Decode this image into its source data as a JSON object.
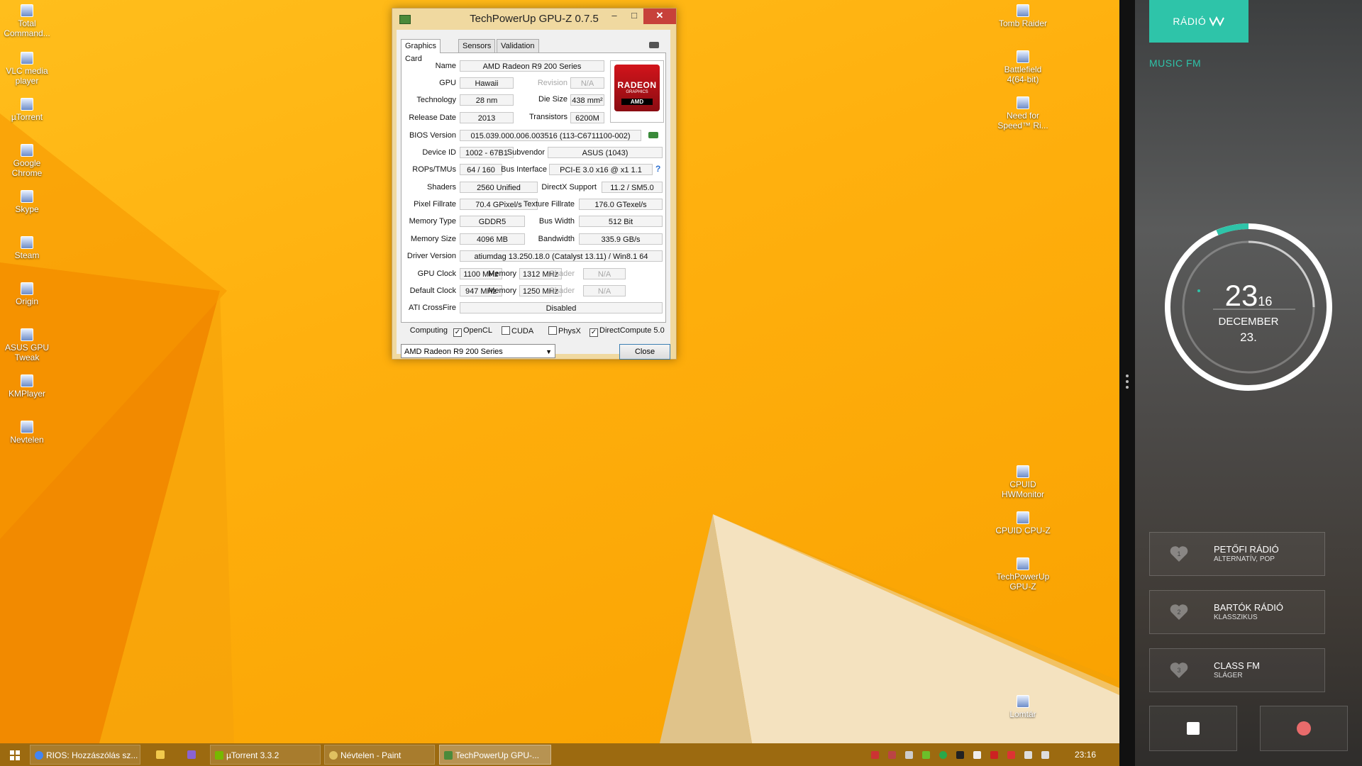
{
  "desktop": {
    "left_icons": [
      {
        "label": "Total Command..."
      },
      {
        "label": "VLC media player"
      },
      {
        "label": "µTorrent"
      },
      {
        "label": "Google Chrome"
      },
      {
        "label": "Skype"
      },
      {
        "label": "Steam"
      },
      {
        "label": "Origin"
      },
      {
        "label": "ASUS GPU Tweak"
      },
      {
        "label": "KMPlayer"
      },
      {
        "label": "Nevtelen"
      }
    ],
    "right_icons": [
      {
        "label": "Tomb Raider"
      },
      {
        "label": "Battlefield 4(64-bit)"
      },
      {
        "label": "Need for Speed™ Ri..."
      },
      {
        "label": "CPUID HWMonitor"
      },
      {
        "label": "CPUID CPU-Z"
      },
      {
        "label": "TechPowerUp GPU-Z"
      },
      {
        "label": "Lomtár"
      }
    ]
  },
  "gpuz": {
    "title": "TechPowerUp GPU-Z 0.7.5",
    "tabs": [
      "Graphics Card",
      "Sensors",
      "Validation"
    ],
    "logo": {
      "line1": "RADEON",
      "line2": "GRAPHICS",
      "line3": "AMD"
    },
    "labels": {
      "name": "Name",
      "gpu": "GPU",
      "revision": "Revision",
      "technology": "Technology",
      "die_size": "Die Size",
      "release_date": "Release Date",
      "transistors": "Transistors",
      "bios_version": "BIOS Version",
      "device_id": "Device ID",
      "subvendor": "Subvendor",
      "rops_tmus": "ROPs/TMUs",
      "bus_interface": "Bus Interface",
      "shaders": "Shaders",
      "directx": "DirectX Support",
      "pixel_fillrate": "Pixel Fillrate",
      "texture_fillrate": "Texture Fillrate",
      "memory_type": "Memory Type",
      "bus_width": "Bus Width",
      "memory_size": "Memory Size",
      "bandwidth": "Bandwidth",
      "driver_version": "Driver Version",
      "gpu_clock": "GPU Clock",
      "memory": "Memory",
      "shader": "Shader",
      "default_clock": "Default Clock",
      "crossfire": "ATI CrossFire",
      "computing": "Computing"
    },
    "values": {
      "name": "AMD Radeon R9 200 Series",
      "gpu": "Hawaii",
      "revision": "N/A",
      "technology": "28 nm",
      "die_size": "438 mm²",
      "release_date": "2013",
      "transistors": "6200M",
      "bios_version": "015.039.000.006.003516 (113-C6711100-002)",
      "device_id": "1002 - 67B1",
      "subvendor": "ASUS (1043)",
      "rops_tmus": "64 / 160",
      "bus_interface": "PCI-E 3.0 x16 @ x1 1.1",
      "shaders": "2560 Unified",
      "directx": "11.2 / SM5.0",
      "pixel_fillrate": "70.4 GPixel/s",
      "texture_fillrate": "176.0 GTexel/s",
      "memory_type": "GDDR5",
      "bus_width": "512 Bit",
      "memory_size": "4096 MB",
      "bandwidth": "335.9 GB/s",
      "driver_version": "atiumdag 13.250.18.0 (Catalyst 13.11) / Win8.1 64",
      "gpu_clock": "1100 MHz",
      "gpu_memory": "1312 MHz",
      "gpu_shader": "N/A",
      "default_clock": "947 MHz",
      "default_memory": "1250 MHz",
      "default_shader": "N/A",
      "crossfire": "Disabled"
    },
    "computing": [
      {
        "label": "OpenCL",
        "checked": true
      },
      {
        "label": "CUDA",
        "checked": false
      },
      {
        "label": "PhysX",
        "checked": false
      },
      {
        "label": "DirectCompute 5.0",
        "checked": true
      }
    ],
    "selected_gpu": "AMD Radeon R9 200 Series",
    "close_label": "Close",
    "bus_help": "?"
  },
  "taskbar": {
    "items": [
      {
        "label": "RIOS: Hozzászólás sz...",
        "color": "#4285f4"
      },
      {
        "label": "",
        "color": "#f2c94c"
      },
      {
        "label": "",
        "color": "#8a63d2"
      },
      {
        "label": "µTorrent 3.3.2",
        "color": "#77b800"
      },
      {
        "label": "Névtelen - Paint",
        "color": "#e0c060"
      },
      {
        "label": "TechPowerUp GPU-...",
        "color": "#4b8a3a"
      }
    ],
    "clock": "23:16"
  },
  "radio": {
    "brand": "RÁDIÓ",
    "now_playing": "MUSIC FM",
    "time_hh": "23",
    "time_mm": "16",
    "date_month": "DECEMBER",
    "date_day": "23.",
    "accent": "#2ec4a9",
    "stations": [
      {
        "num": "1",
        "name": "PETŐFI RÁDIÓ",
        "genre": "ALTERNATÍV, POP"
      },
      {
        "num": "2",
        "name": "BARTÓK RÁDIÓ",
        "genre": "KLASSZIKUS"
      },
      {
        "num": "3",
        "name": "CLASS FM",
        "genre": "SLÁGER"
      }
    ]
  }
}
